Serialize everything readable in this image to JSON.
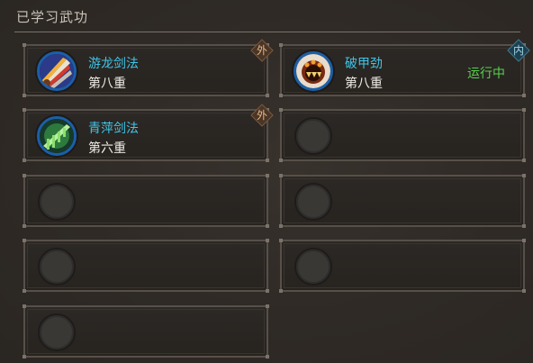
{
  "panel": {
    "title": "已学习武功"
  },
  "skills": [
    {
      "name": "游龙剑法",
      "level": "第八重",
      "badge": "外",
      "status": "",
      "icon": "sword-fan-icon"
    },
    {
      "name": "破甲劲",
      "level": "第八重",
      "badge": "内",
      "status": "运行中",
      "icon": "beast-fist-icon"
    },
    {
      "name": "青萍剑法",
      "level": "第六重",
      "badge": "外",
      "status": "",
      "icon": "green-sword-icon"
    }
  ],
  "colors": {
    "skill_name": "#3fc6e8",
    "running": "#57d14e",
    "icon_ring": "#1c5fa8"
  }
}
